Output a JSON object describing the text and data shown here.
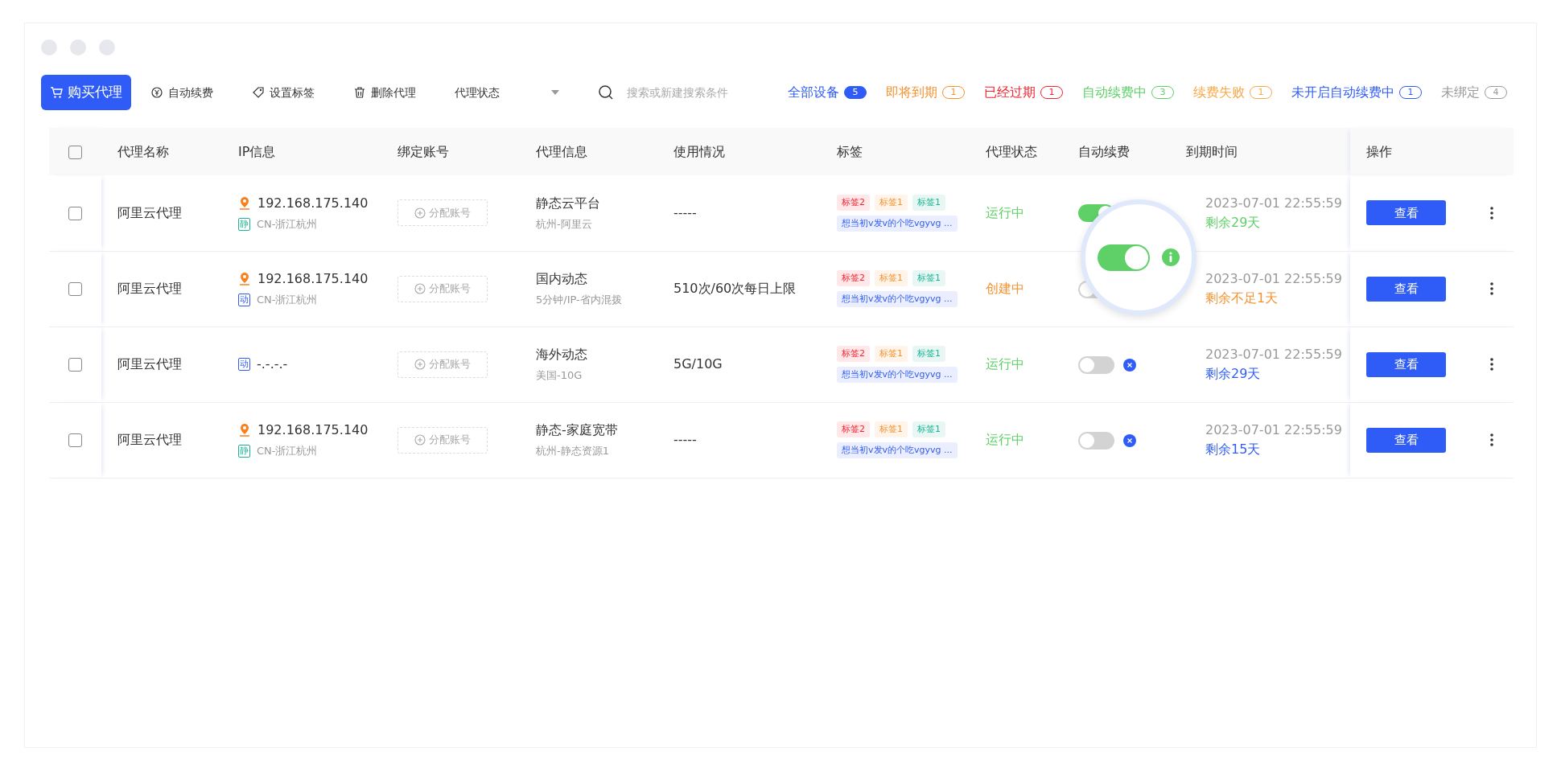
{
  "toolbar": {
    "buy_button": "购买代理",
    "actions": [
      {
        "label": "自动续费",
        "kind": "renew"
      },
      {
        "label": "设置标签",
        "kind": "tag"
      },
      {
        "label": "删除代理",
        "kind": "trash"
      }
    ],
    "status_select": "代理状态",
    "search": {
      "placeholder": "搜索或新建搜索条件"
    }
  },
  "filters": [
    {
      "label": "全部设备",
      "count": "5",
      "color": "#2f5cf6",
      "selected": true
    },
    {
      "label": "即将到期",
      "count": "1",
      "color": "#f5922f",
      "selected": false
    },
    {
      "label": "已经过期",
      "count": "1",
      "color": "#f5222d",
      "selected": false
    },
    {
      "label": "自动续费中",
      "count": "3",
      "color": "#5fd068",
      "selected": false
    },
    {
      "label": "续费失败",
      "count": "1",
      "color": "#f7a94a",
      "selected": false
    },
    {
      "label": "未开启自动续费中",
      "count": "1",
      "color": "#2f5cf6",
      "selected": false
    },
    {
      "label": "未绑定",
      "count": "4",
      "color": "#9a9a9a",
      "selected": false
    }
  ],
  "table": {
    "all_checked": false,
    "columns": [
      "代理名称",
      "IP信息",
      "绑定账号",
      "代理信息",
      "使用情况",
      "标签",
      "代理状态",
      "自动续费",
      "到期时间",
      "操作"
    ],
    "rows": [
      {
        "checked": false,
        "name": "阿里云代理",
        "ip": "192.168.175.140",
        "located": true,
        "ip_type": {
          "text": "静",
          "kind": "static"
        },
        "region": "CN-浙江杭州",
        "bind": "分配账号",
        "info": "静态云平台",
        "info_sub": "杭州-阿里云",
        "usage": "-----",
        "tags": [
          {
            "text": "标签2",
            "color": "#f5222d"
          },
          {
            "text": "标签1",
            "color": "#f5922f"
          },
          {
            "text": "标签1",
            "color": "#1ab394"
          },
          {
            "text": "想当初v发v的个吃vgyvg ...",
            "color": "#2f5cf6"
          }
        ],
        "status": {
          "text": "运行中",
          "kind": "running"
        },
        "auto_renew": true,
        "expiry": "2023-07-01 22:55:59",
        "remaining": {
          "text": "剩余29天",
          "kind": "ok"
        },
        "action": "查看"
      },
      {
        "checked": false,
        "name": "阿里云代理",
        "ip": "192.168.175.140",
        "located": true,
        "ip_type": {
          "text": "动",
          "kind": "dynamic"
        },
        "region": "CN-浙江杭州",
        "bind": "分配账号",
        "info": "国内动态",
        "info_sub": "5分钟/IP-省内混拨",
        "usage": "510次/60次每日上限",
        "tags": [
          {
            "text": "标签2",
            "color": "#f5222d"
          },
          {
            "text": "标签1",
            "color": "#f5922f"
          },
          {
            "text": "标签1",
            "color": "#1ab394"
          },
          {
            "text": "想当初v发v的个吃vgyvg ...",
            "color": "#2f5cf6"
          }
        ],
        "status": {
          "text": "创建中",
          "kind": "creating"
        },
        "auto_renew": false,
        "expiry": "2023-07-01 22:55:59",
        "remaining": {
          "text": "剩余不足1天",
          "kind": "warning"
        },
        "action": "查看"
      },
      {
        "checked": false,
        "name": "阿里云代理",
        "ip": "-.-.-.-",
        "located": false,
        "ip_type": {
          "text": "动",
          "kind": "dynamic"
        },
        "bind": "分配账号",
        "info": "海外动态",
        "info_sub": "美国-10G",
        "usage": "5G/10G",
        "tags": [
          {
            "text": "标签2",
            "color": "#f5222d"
          },
          {
            "text": "标签1",
            "color": "#f5922f"
          },
          {
            "text": "标签1",
            "color": "#1ab394"
          },
          {
            "text": "想当初v发v的个吃vgyvg ...",
            "color": "#2f5cf6"
          }
        ],
        "status": {
          "text": "运行中",
          "kind": "running"
        },
        "auto_renew": false,
        "renew_failed": true,
        "expiry": "2023-07-01 22:55:59",
        "remaining": {
          "text": "剩余29天",
          "kind": "normal"
        },
        "action": "查看"
      },
      {
        "checked": false,
        "name": "阿里云代理",
        "ip": "192.168.175.140",
        "located": true,
        "ip_type": {
          "text": "静",
          "kind": "static"
        },
        "region": "CN-浙江杭州",
        "bind": "分配账号",
        "info": "静态-家庭宽带",
        "info_sub": "杭州-静态资源1",
        "usage": "-----",
        "tags": [
          {
            "text": "标签2",
            "color": "#f5222d"
          },
          {
            "text": "标签1",
            "color": "#f5922f"
          },
          {
            "text": "标签1",
            "color": "#1ab394"
          },
          {
            "text": "想当初v发v的个吃vgyvg ...",
            "color": "#2f5cf6"
          }
        ],
        "status": {
          "text": "运行中",
          "kind": "running"
        },
        "auto_renew": false,
        "renew_failed": true,
        "expiry": "2023-07-01 22:55:59",
        "remaining": {
          "text": "剩余15天",
          "kind": "normal"
        },
        "action": "查看"
      }
    ]
  },
  "magnifier": {
    "on": true
  }
}
